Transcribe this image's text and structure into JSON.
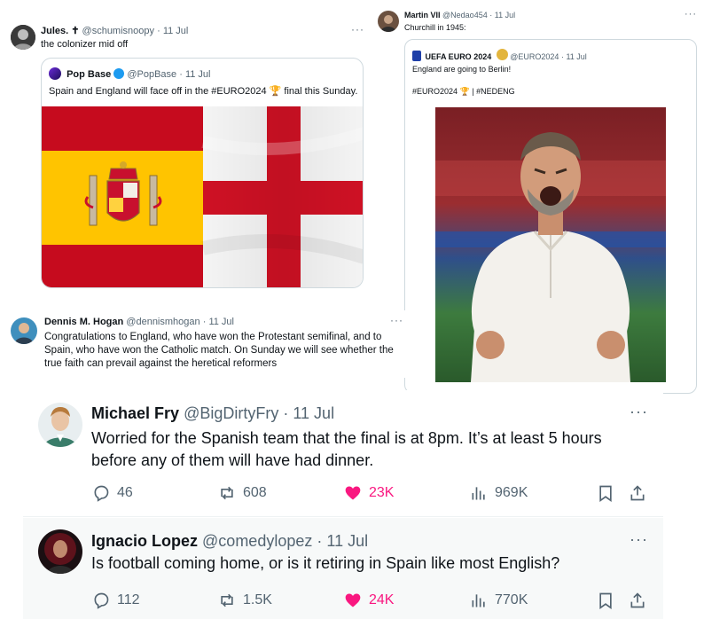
{
  "tweet_jules": {
    "name": "Jules.",
    "name_suffix": "✝",
    "handle": "@schumisnoopy",
    "date": "11 Jul",
    "text": "the colonizer mid off",
    "more": "···"
  },
  "quote_popbase": {
    "name": "Pop Base",
    "handle": "@PopBase",
    "date": "11 Jul",
    "text": "Spain and England will face off in the #EURO2024 🏆 final this Sunday."
  },
  "tweet_martin": {
    "name": "Martin VII",
    "handle": "@Nedao454",
    "date": "11 Jul",
    "text": "Churchill in 1945:",
    "more": "···"
  },
  "quote_uefa": {
    "name": "UEFA EURO 2024",
    "handle": "@EURO2024",
    "date": "11 Jul",
    "text": "England are going to Berlin!",
    "hashtags": "#EURO2024 🏆 | #NEDENG"
  },
  "tweet_dennis": {
    "name": "Dennis M. Hogan",
    "handle": "@dennismhogan",
    "date": "11 Jul",
    "text": "Congratulations to England, who have won the Protestant semifinal, and to Spain, who have won the Catholic match. On Sunday we will see whether the true faith can prevail against the heretical reformers",
    "more": "···"
  },
  "tweet_michael": {
    "name": "Michael Fry",
    "handle": "@BigDirtyFry",
    "date": "11 Jul",
    "text": "Worried for the Spanish team that the final is at 8pm. It’s at least 5 hours before any of them will have had dinner.",
    "more": "···",
    "replies": "46",
    "retweets": "608",
    "likes": "23K",
    "views": "969K"
  },
  "tweet_ignacio": {
    "name": "Ignacio Lopez",
    "handle": "@comedylopez",
    "date": "11 Jul",
    "text": "Is football coming home, or is it retiring in Spain like most English?",
    "more": "···",
    "replies": "112",
    "retweets": "1.5K",
    "likes": "24K",
    "views": "770K"
  },
  "colors": {
    "like": "#f91880",
    "muted": "#536471",
    "text": "#0f1419",
    "border": "#cfd9de",
    "spain_red": "#c60b1e",
    "spain_yellow": "#ffc400",
    "england_red": "#ce1124"
  },
  "icons": {
    "reply": "reply-icon",
    "retweet": "retweet-icon",
    "like": "heart-icon",
    "views": "views-icon",
    "bookmark": "bookmark-icon",
    "share": "share-icon"
  }
}
